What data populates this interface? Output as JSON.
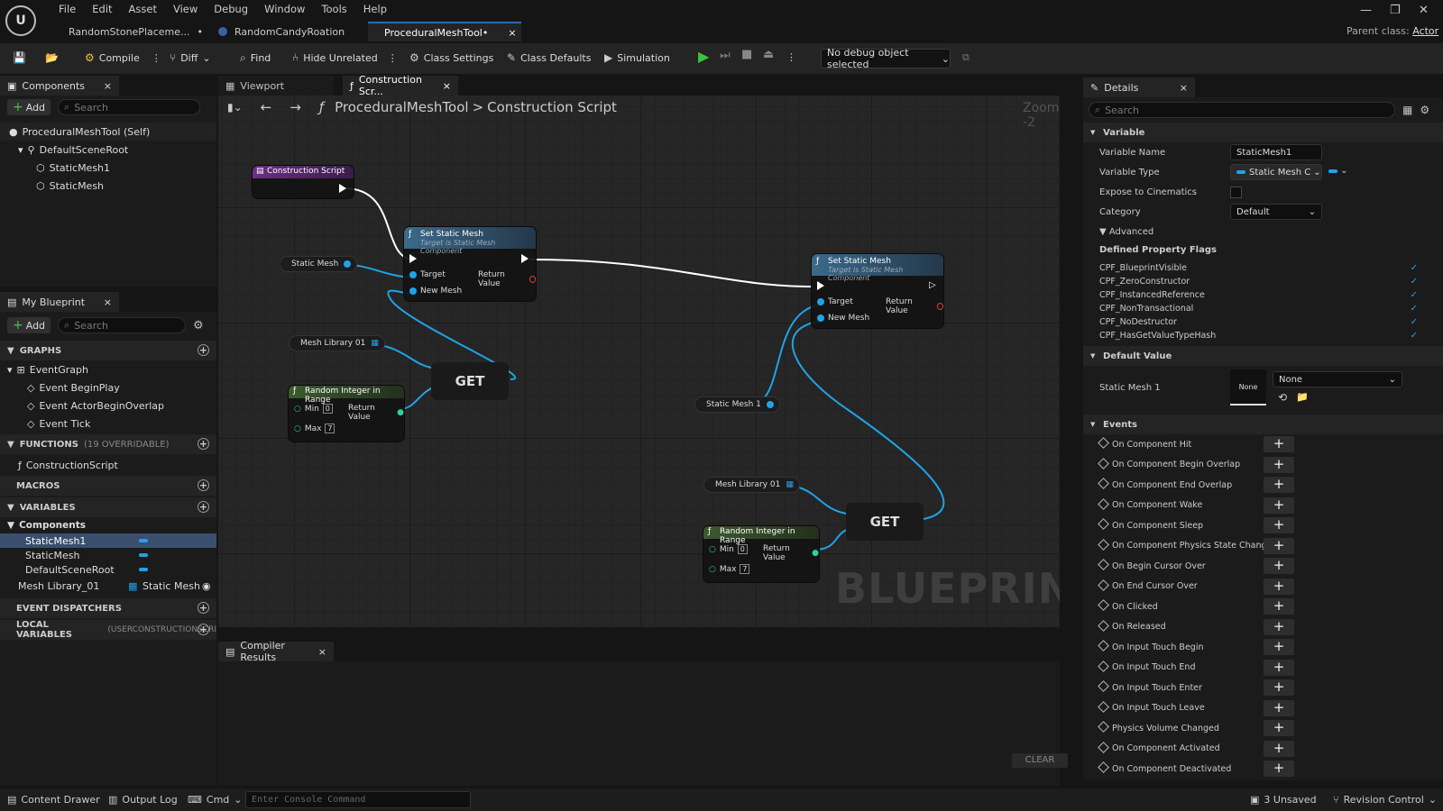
{
  "app": {
    "logo": "unreal-logo",
    "parent_class_label": "Parent class:",
    "parent_class": "Actor"
  },
  "menu": [
    "File",
    "Edit",
    "Asset",
    "View",
    "Debug",
    "Window",
    "Tools",
    "Help"
  ],
  "doc_tabs": [
    {
      "label": "RandomStonePlaceme...",
      "modified": "•"
    },
    {
      "label": "RandomCandyRoation"
    },
    {
      "label": "ProceduralMeshTool•",
      "active": true
    }
  ],
  "toolbar": {
    "compile": "Compile",
    "diff": "Diff",
    "find": "Find",
    "hide_unrelated": "Hide Unrelated",
    "class_settings": "Class Settings",
    "class_defaults": "Class Defaults",
    "simulation": "Simulation",
    "debug_object": "No debug object selected"
  },
  "components": {
    "title": "Components",
    "add": "Add",
    "search_placeholder": "Search",
    "items": [
      "ProceduralMeshTool (Self)",
      "DefaultSceneRoot",
      "StaticMesh1",
      "StaticMesh"
    ]
  },
  "my_blueprint": {
    "title": "My Blueprint",
    "add": "Add",
    "search_placeholder": "Search",
    "graphs_label": "GRAPHS",
    "event_graph": "EventGraph",
    "events": [
      "Event BeginPlay",
      "Event ActorBeginOverlap",
      "Event Tick"
    ],
    "functions_label": "FUNCTIONS",
    "functions_note": "(19 OVERRIDABLE)",
    "construction_script": "ConstructionScript",
    "macros_label": "MACROS",
    "variables_label": "VARIABLES",
    "components_cat": "Components",
    "variables": [
      "StaticMesh1",
      "StaticMesh",
      "DefaultSceneRoot"
    ],
    "mesh_library": "Mesh Library_01",
    "mesh_library_type": "Static Mesh",
    "event_dispatchers": "EVENT DISPATCHERS",
    "local_vars": "LOCAL VARIABLES",
    "local_vars_note": "(USERCONSTRUCTIONSCRI"
  },
  "graph_tabs": {
    "viewport": "Viewport",
    "construction": "Construction Scr..."
  },
  "breadcrumb": {
    "root": "ProceduralMeshTool",
    "sep": ">",
    "current": "Construction Script",
    "zoom": "Zoom -2"
  },
  "nodes": {
    "construction_script": "Construction Script",
    "set_static_mesh": "Set Static Mesh",
    "target_note": "Target is Static Mesh Component",
    "target": "Target",
    "return_value": "Return Value",
    "new_mesh": "New Mesh",
    "static_mesh_var": "Static Mesh",
    "static_mesh1_var": "Static Mesh 1",
    "mesh_library_var": "Mesh Library 01",
    "get": "GET",
    "random_int": "Random Integer in Range",
    "min": "Min",
    "max": "Max",
    "min_val": "0",
    "max_val": "7"
  },
  "watermark": "BLUEPRINT",
  "compiler": {
    "title": "Compiler Results",
    "clear": "CLEAR"
  },
  "details": {
    "title": "Details",
    "search_placeholder": "Search",
    "variable_section": "Variable",
    "variable_name_label": "Variable Name",
    "variable_name": "StaticMesh1",
    "variable_type_label": "Variable Type",
    "variable_type": "Static Mesh C",
    "expose_label": "Expose to Cinematics",
    "category_label": "Category",
    "category": "Default",
    "advanced": "Advanced",
    "defined_flags": "Defined Property Flags",
    "flags": [
      "CPF_BlueprintVisible",
      "CPF_ZeroConstructor",
      "CPF_InstancedReference",
      "CPF_NonTransactional",
      "CPF_NoDestructor",
      "CPF_HasGetValueTypeHash"
    ],
    "default_value": "Default Value",
    "static_mesh1_label": "Static Mesh 1",
    "thumb": "None",
    "mesh_value": "None",
    "events_section": "Events",
    "events": [
      "On Component Hit",
      "On Component Begin Overlap",
      "On Component End Overlap",
      "On Component Wake",
      "On Component Sleep",
      "On Component Physics State Changed",
      "On Begin Cursor Over",
      "On End Cursor Over",
      "On Clicked",
      "On Released",
      "On Input Touch Begin",
      "On Input Touch End",
      "On Input Touch Enter",
      "On Input Touch Leave",
      "Physics Volume Changed",
      "On Component Activated",
      "On Component Deactivated"
    ]
  },
  "statusbar": {
    "content_drawer": "Content Drawer",
    "output_log": "Output Log",
    "cmd": "Cmd",
    "console_placeholder": "Enter Console Command",
    "unsaved": "3 Unsaved",
    "revision": "Revision Control"
  },
  "colors": {
    "accent": "#2a6db0",
    "pin_blue": "#1fa3e8",
    "exec": "#ffffff",
    "function_header": "#3b6a8a",
    "pure_header": "#3c5a2f",
    "event_header": "#5a2d6e"
  }
}
